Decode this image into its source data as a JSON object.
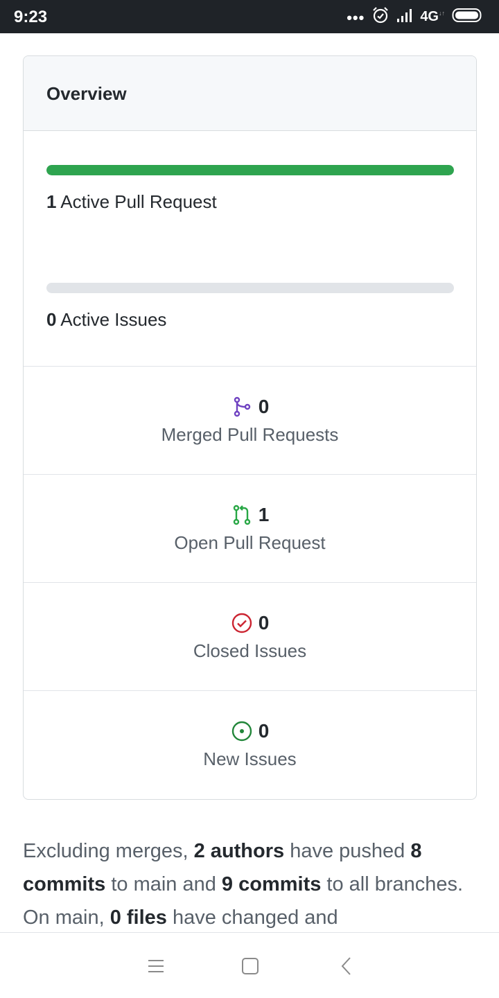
{
  "status_bar": {
    "time": "9:23",
    "dots": "•••",
    "network": "4G",
    "network_sub": "↓↑"
  },
  "overview": {
    "title": "Overview",
    "active_pull_requests": {
      "count": "1",
      "label": "Active Pull Request",
      "progress": 1.0
    },
    "active_issues": {
      "count": "0",
      "label": "Active Issues",
      "progress": 0.0
    },
    "stats": [
      {
        "icon": "merge-icon",
        "count": "0",
        "label": "Merged Pull Requests",
        "color": "#6f42c1"
      },
      {
        "icon": "pull-request-icon",
        "count": "1",
        "label": "Open Pull Request",
        "color": "#28a745"
      },
      {
        "icon": "closed-issue-icon",
        "count": "0",
        "label": "Closed Issues",
        "color": "#cb2431"
      },
      {
        "icon": "new-issue-icon",
        "count": "0",
        "label": "New Issues",
        "color": "#22863a"
      }
    ]
  },
  "description": {
    "t1": "Excluding merges, ",
    "b1": "2 authors",
    "t2": " have pushed ",
    "b2": "8 commits",
    "t3": " to main and ",
    "b3": "9 commits",
    "t4": " to all branches. On main, ",
    "b4": "0 files",
    "t5": " have changed and"
  },
  "colors": {
    "progress_fill": "#2ea44f",
    "progress_track": "#e1e4e8",
    "status_bar": "#1f2328"
  },
  "nav_bar": {
    "icons": [
      "menu-icon",
      "home-square-icon",
      "back-chevron-icon"
    ]
  }
}
